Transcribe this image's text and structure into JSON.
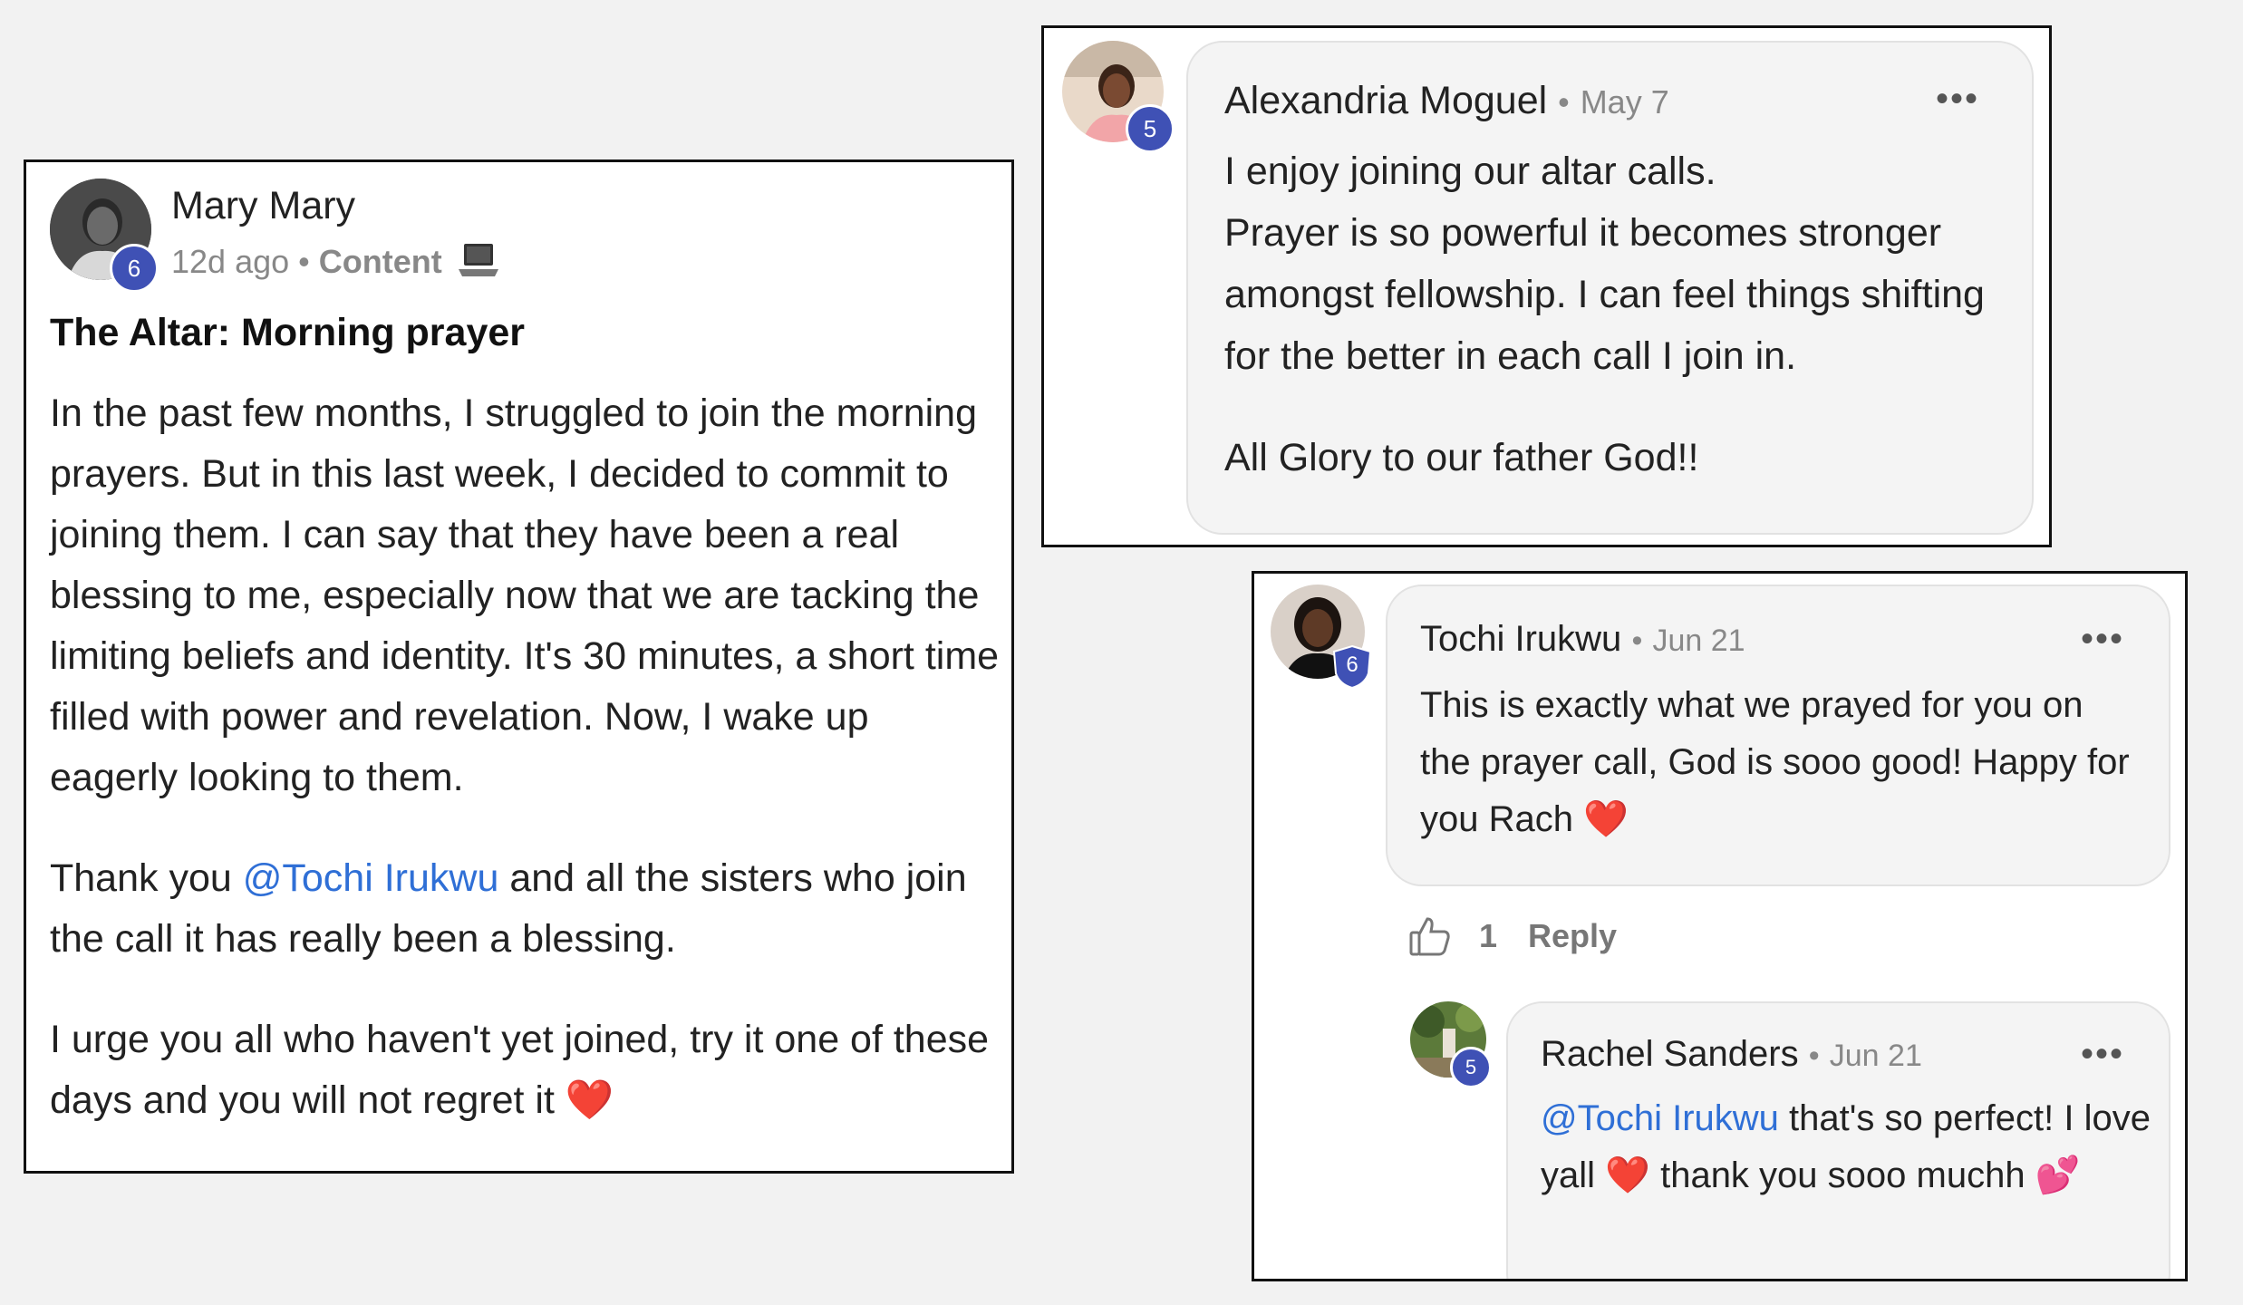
{
  "post": {
    "author": "Mary Mary",
    "badge": "6",
    "time": "12d ago",
    "separator": "•",
    "category": "Content",
    "category_icon": "laptop-icon",
    "title": "The Altar: Morning prayer",
    "paragraph1": "In the past few months, I struggled to join the morning prayers. But in this last week, I decided to commit to joining them. I can say that they have been a real blessing to me, especially now that we are tacking the limiting beliefs and identity. It's 30 minutes, a short time filled with power and revelation. Now, I wake up eagerly looking to them.",
    "paragraph2_before": "Thank you ",
    "paragraph2_mention": "@Tochi Irukwu",
    "paragraph2_after": " and all the sisters who join the call it has really been a blessing.",
    "paragraph3": "I urge you all who haven't yet joined, try it one of these days and you will not regret it",
    "paragraph3_emoji": "❤️"
  },
  "comment_alexandria": {
    "author": "Alexandria Moguel",
    "badge": "5",
    "separator": "•",
    "date": "May 7",
    "more": "•••",
    "line1": "I enjoy joining our altar calls.",
    "line2": "Prayer is so powerful it becomes stronger amongst fellowship. I can feel things shifting for the better in each call I join in.",
    "line3": "All Glory to our father God!!"
  },
  "comment_tochi": {
    "author": "Tochi Irukwu",
    "badge": "6",
    "separator": "•",
    "date": "Jun 21",
    "more": "•••",
    "text": "This is exactly what we prayed for you on the prayer call, God is sooo good! Happy for you Rach",
    "emoji": "❤️",
    "like_count": "1",
    "reply_label": "Reply"
  },
  "reply_rachel": {
    "author": "Rachel Sanders",
    "badge": "5",
    "separator": "•",
    "date": "Jun 21",
    "more": "•••",
    "mention": "@Tochi Irukwu",
    "text_part1": " that's so perfect! I love yall",
    "emoji1": "❤️",
    "text_part2": " thank you sooo muchh",
    "emoji2": "💕"
  }
}
